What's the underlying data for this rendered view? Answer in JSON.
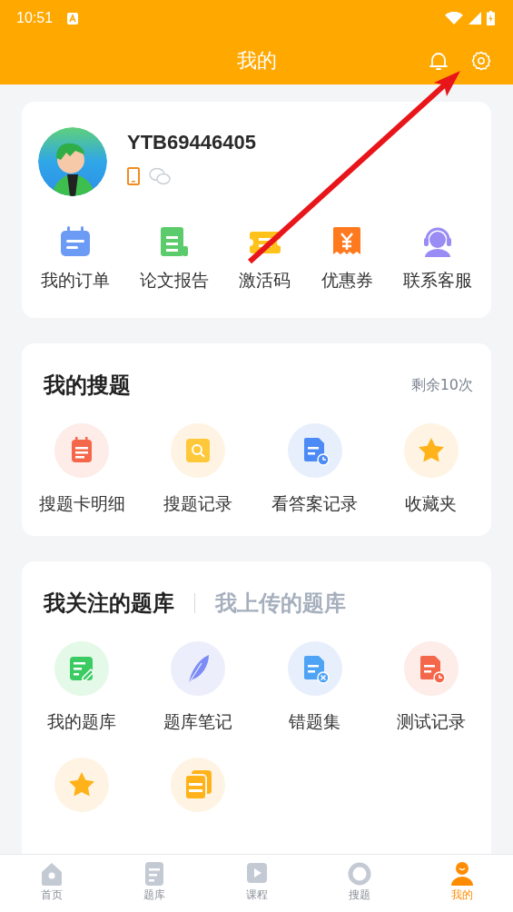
{
  "status_bar": {
    "time": "10:51"
  },
  "header": {
    "title": "我的"
  },
  "profile": {
    "username": "YTB69446405",
    "shortcuts": [
      {
        "label": "我的订单"
      },
      {
        "label": "论文报告"
      },
      {
        "label": "激活码"
      },
      {
        "label": "优惠券"
      },
      {
        "label": "联系客服"
      }
    ]
  },
  "search_section": {
    "title": "我的搜题",
    "remaining": "剩余10次",
    "items": [
      {
        "label": "搜题卡明细"
      },
      {
        "label": "搜题记录"
      },
      {
        "label": "看答案记录"
      },
      {
        "label": "收藏夹"
      }
    ]
  },
  "bank_section": {
    "tabs": [
      {
        "label": "我关注的题库",
        "selected": true
      },
      {
        "label": "我上传的题库",
        "selected": false
      }
    ],
    "items": [
      {
        "kind": "labeled",
        "label": "我的题库"
      },
      {
        "kind": "labeled",
        "label": "题库笔记"
      },
      {
        "kind": "labeled",
        "label": "错题集"
      },
      {
        "kind": "labeled",
        "label": "测试记录"
      },
      {
        "kind": "icon_only"
      },
      {
        "kind": "icon_only"
      }
    ]
  },
  "bottom_nav": [
    {
      "label": "首页",
      "selected": false
    },
    {
      "label": "题库",
      "selected": false
    },
    {
      "label": "课程",
      "selected": false
    },
    {
      "label": "搜题",
      "selected": false
    },
    {
      "label": "我的",
      "selected": true
    }
  ]
}
